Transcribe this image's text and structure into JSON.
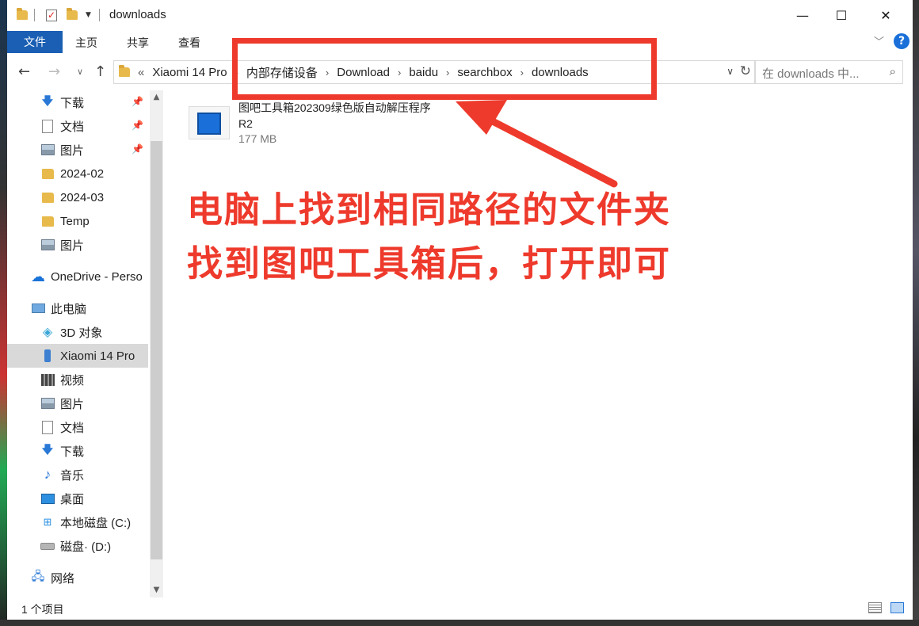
{
  "window": {
    "title": "downloads"
  },
  "controls": {
    "minimize": "—",
    "maximize": "☐",
    "close": "✕"
  },
  "ribbon": {
    "file": "文件",
    "tabs": [
      "主页",
      "共享",
      "查看"
    ],
    "help": "?"
  },
  "address": {
    "overflow": "«",
    "segments": [
      "Xiaomi 14 Pro",
      "内部存储设备",
      "Download",
      "baidu",
      "searchbox",
      "downloads"
    ]
  },
  "search": {
    "placeholder": "在 downloads 中..."
  },
  "sidebar": {
    "quick_access": [
      {
        "label": "下载",
        "icon": "download-arrow-icon",
        "pinned": true
      },
      {
        "label": "文档",
        "icon": "document-icon",
        "pinned": true
      },
      {
        "label": "图片",
        "icon": "picture-icon",
        "pinned": true
      },
      {
        "label": "2024-02",
        "icon": "folder-icon",
        "pinned": false
      },
      {
        "label": "2024-03",
        "icon": "folder-icon",
        "pinned": false
      },
      {
        "label": "Temp",
        "icon": "folder-icon",
        "pinned": false
      },
      {
        "label": "图片",
        "icon": "picture-icon",
        "pinned": false
      }
    ],
    "onedrive": "OneDrive - Perso",
    "this_pc": "此电脑",
    "pc_items": [
      {
        "label": "3D 对象",
        "icon": "cube-icon"
      },
      {
        "label": "Xiaomi 14 Pro",
        "icon": "phone-icon",
        "selected": true
      },
      {
        "label": "视频",
        "icon": "video-icon"
      },
      {
        "label": "图片",
        "icon": "picture-icon"
      },
      {
        "label": "文档",
        "icon": "document-icon"
      },
      {
        "label": "下载",
        "icon": "download-arrow-icon"
      },
      {
        "label": "音乐",
        "icon": "music-icon"
      },
      {
        "label": "桌面",
        "icon": "desktop-icon"
      },
      {
        "label": "本地磁盘 (C:)",
        "icon": "windows-drive-icon"
      },
      {
        "label": "磁盘· (D:)",
        "icon": "drive-icon"
      }
    ],
    "network": "网络"
  },
  "files": [
    {
      "name": "图吧工具箱202309绿色版自动解压程序R2",
      "size": "177 MB"
    }
  ],
  "annotation": {
    "line1": "电脑上找到相同路径的文件夹",
    "line2": "找到图吧工具箱后，打开即可",
    "color": "#ee3a2c"
  },
  "status": {
    "count": "1 个项目"
  }
}
